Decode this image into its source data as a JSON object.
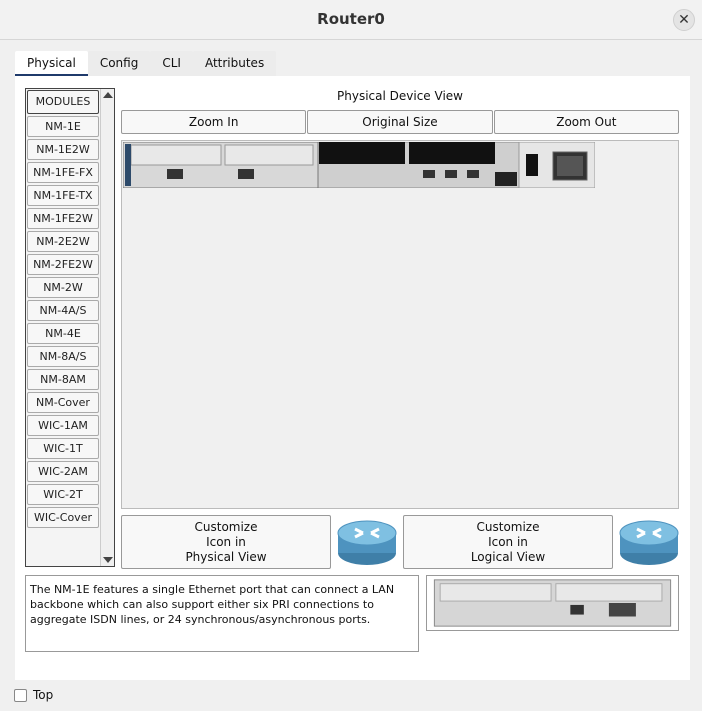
{
  "window": {
    "title": "Router0"
  },
  "tabs": [
    {
      "label": "Physical",
      "active": true
    },
    {
      "label": "Config",
      "active": false
    },
    {
      "label": "CLI",
      "active": false
    },
    {
      "label": "Attributes",
      "active": false
    }
  ],
  "modules": {
    "header": "MODULES",
    "items": [
      "NM-1E",
      "NM-1E2W",
      "NM-1FE-FX",
      "NM-1FE-TX",
      "NM-1FE2W",
      "NM-2E2W",
      "NM-2FE2W",
      "NM-2W",
      "NM-4A/S",
      "NM-4E",
      "NM-8A/S",
      "NM-8AM",
      "NM-Cover",
      "WIC-1AM",
      "WIC-1T",
      "WIC-2AM",
      "WIC-2T",
      "WIC-Cover"
    ]
  },
  "physical_view": {
    "label": "Physical Device View",
    "zoom_in": "Zoom In",
    "original_size": "Original Size",
    "zoom_out": "Zoom Out"
  },
  "customize": {
    "physical": [
      "Customize",
      "Icon in",
      "Physical View"
    ],
    "logical": [
      "Customize",
      "Icon in",
      "Logical View"
    ]
  },
  "description": "The NM-1E features a single Ethernet port that can connect a LAN backbone which can also support either six PRI connections to aggregate ISDN lines, or 24 synchronous/asynchronous ports.",
  "footer": {
    "top_label": "Top",
    "top_checked": false
  }
}
